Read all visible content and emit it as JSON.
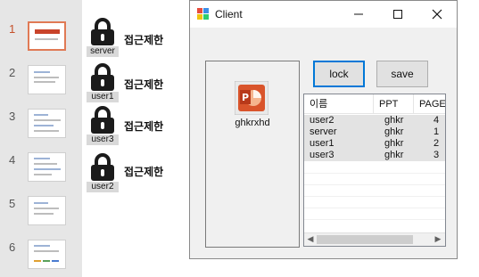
{
  "slides": {
    "items": [
      {
        "number": "1",
        "active": true
      },
      {
        "number": "2",
        "active": false
      },
      {
        "number": "3",
        "active": false
      },
      {
        "number": "4",
        "active": false
      },
      {
        "number": "5",
        "active": false
      },
      {
        "number": "6",
        "active": false
      }
    ]
  },
  "locks": {
    "items": [
      {
        "user": "server",
        "status": "접근제한"
      },
      {
        "user": "user1",
        "status": "접근제한"
      },
      {
        "user": "user3",
        "status": "접근제한"
      },
      {
        "user": "user2",
        "status": "접근제한"
      }
    ]
  },
  "window": {
    "title": "Client",
    "file_caption": "ghkrxhd",
    "file_icon": "powerpoint-file-icon",
    "lock_label": "lock",
    "save_label": "save",
    "accent": "#0078d7"
  },
  "list": {
    "columns": [
      "이름",
      "PPT",
      "PAGE"
    ],
    "rows": [
      [
        "user2",
        "ghkr",
        "4"
      ],
      [
        "server",
        "ghkr",
        "1"
      ],
      [
        "user1",
        "ghkr",
        "2"
      ],
      [
        "user3",
        "ghkr",
        "3"
      ]
    ]
  }
}
